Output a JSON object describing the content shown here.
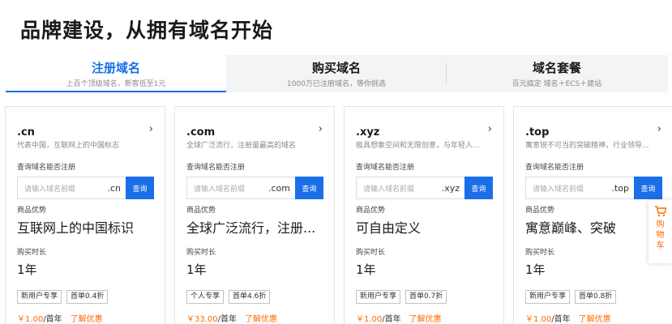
{
  "page_title": "品牌建设，从拥有域名开始",
  "tabs": [
    {
      "label": "注册域名",
      "desc": "上百个顶级域名，新客低至1元",
      "active": true
    },
    {
      "label": "购买域名",
      "desc": "1000万已注册域名，等你挑选",
      "active": false
    },
    {
      "label": "域名套餐",
      "desc": "百元搞定 域名＋ECS＋建站",
      "active": false
    }
  ],
  "cards": [
    {
      "suffix": ".cn",
      "desc": "代表中国，互联网上的中国标志",
      "query_label": "查询域名能否注册",
      "placeholder": "请输入域名前缀",
      "input_suffix": ".cn",
      "search_label": "查询",
      "advantage_label": "商品优势",
      "advantage": "互联网上的中国标识",
      "duration_label": "购买时长",
      "duration": "1年",
      "badges": [
        "新用户专享",
        "首单0.4折"
      ],
      "price": "￥1.00",
      "price_unit": "/首年",
      "discount_link": "了解优惠"
    },
    {
      "suffix": ".com",
      "desc": "全球广泛流行，注册量最高的域名",
      "query_label": "查询域名能否注册",
      "placeholder": "请输入域名前缀",
      "input_suffix": ".com",
      "search_label": "查询",
      "advantage_label": "商品优势",
      "advantage": "全球广泛流行，注册...",
      "duration_label": "购买时长",
      "duration": "1年",
      "badges": [
        "个人专享",
        "首单4.6折"
      ],
      "price": "￥33.00",
      "price_unit": "/首年",
      "discount_link": "了解优惠"
    },
    {
      "suffix": ".xyz",
      "desc": "极具想象空间和无限创意，与年轻人...",
      "query_label": "查询域名能否注册",
      "placeholder": "请输入域名前缀",
      "input_suffix": ".xyz",
      "search_label": "查询",
      "advantage_label": "商品优势",
      "advantage": "可自由定义",
      "duration_label": "购买时长",
      "duration": "1年",
      "badges": [
        "新用户专享",
        "首单0.7折"
      ],
      "price": "￥1.00",
      "price_unit": "/首年",
      "discount_link": "了解优惠"
    },
    {
      "suffix": ".top",
      "desc": "寓意锐不可当的突破精神，行业领导...",
      "query_label": "查询域名能否注册",
      "placeholder": "请输入域名前缀",
      "input_suffix": ".top",
      "search_label": "查询",
      "advantage_label": "商品优势",
      "advantage": "寓意巅峰、突破",
      "duration_label": "购买时长",
      "duration": "1年",
      "badges": [
        "新用户专享",
        "首单0.8折"
      ],
      "price": "￥1.00",
      "price_unit": "/首年",
      "discount_link": "了解优惠"
    }
  ],
  "cart": {
    "label": "购物车",
    "icon": "shopping-cart-icon"
  },
  "colors": {
    "accent": "#1a6ee8",
    "price": "#ff6a00"
  }
}
